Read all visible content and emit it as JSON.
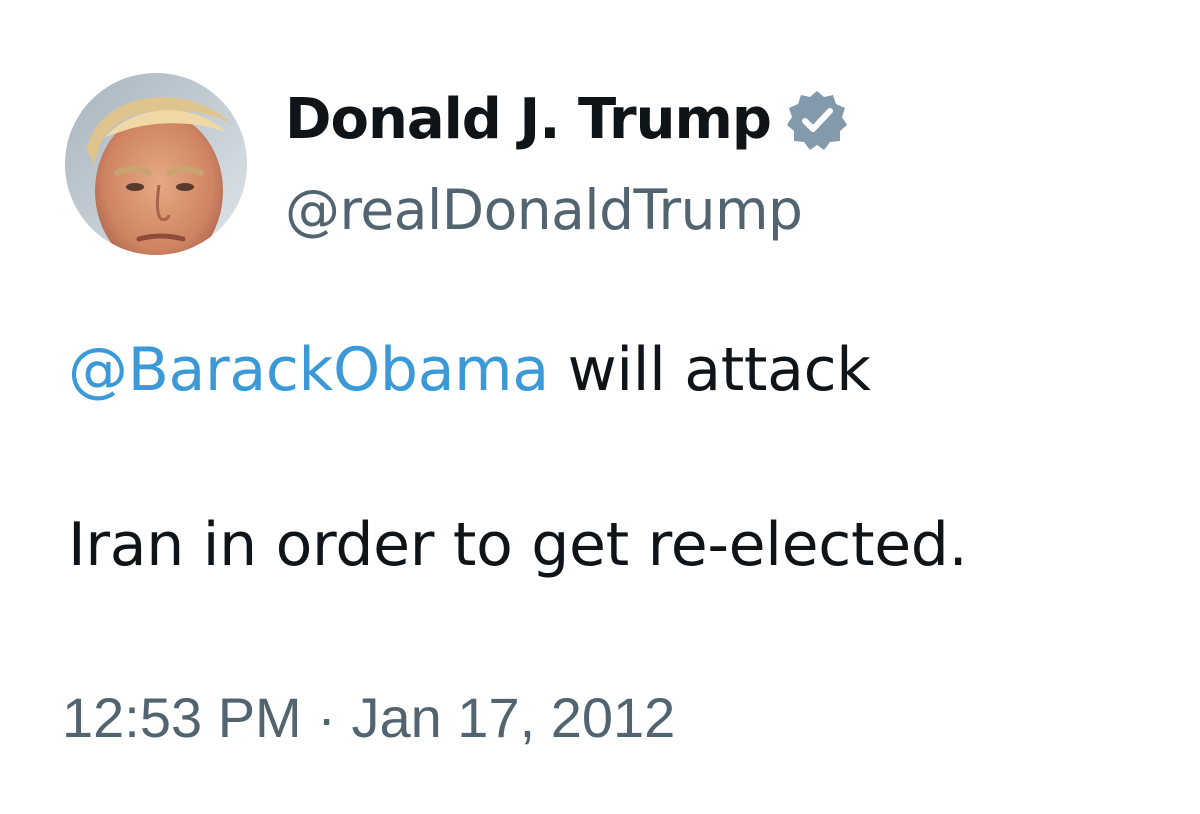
{
  "tweet": {
    "author": {
      "display_name": "Donald J. Trump",
      "handle": "@realDonaldTrump",
      "verified": true,
      "avatar_icon": "profile-photo-avatar"
    },
    "body": {
      "line1": {
        "mention": "@BarackObama",
        "rest": " will attack"
      },
      "line2": "Iran in order to get re-elected."
    },
    "timestamp": "12:53 PM · Jan 17, 2012"
  },
  "colors": {
    "text_primary": "#0f1419",
    "text_secondary": "#536471",
    "mention_blue": "#3b99d8",
    "verified_badge": "#829aab"
  }
}
